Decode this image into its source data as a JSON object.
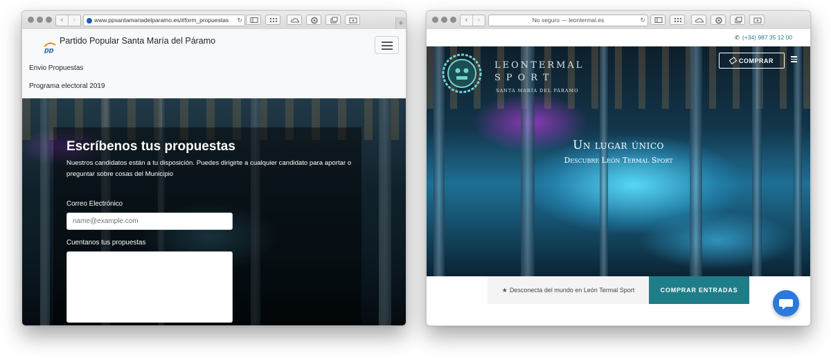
{
  "window1": {
    "address": "www.ppsantamariadelparamo.es/#form_propuestas",
    "site": {
      "brand": "Partido Popular Santa María del Páramo",
      "nav_links": [
        "Envio Propuestas",
        "Programa electoral 2019"
      ],
      "heading": "Escríbenos tus propuestas",
      "lead": "Nuestros candidatos están a tu disposición. Puedes dirigirte a cualquier candidato para aportar o preguntar sobre cosas del Municipio",
      "email_label": "Correo Electrónico",
      "email_placeholder": "name@example.com",
      "proposals_label": "Cuentanos tus propuestas"
    }
  },
  "window2": {
    "address": "No seguro — leontermal.es",
    "site": {
      "phone": "(+34) 987 35 12 00",
      "logo_line1": "LEONTERMAL",
      "logo_line2": "SPORT",
      "logo_line3": "SANTA MARÍA DEL PÁRAMO",
      "comprar_label": "COMPRAR",
      "slogan_title": "Un lugar único",
      "slogan_sub": "Descubre León Termal Sport",
      "bar_text": "Desconecta del mundo en León Termal Sport",
      "cta_label": "COMPRAR ENTRADAS"
    }
  },
  "colors": {
    "accent_teal": "#1f7d88",
    "chat_blue": "#2b79d9",
    "pp_blue": "#1b5fb3",
    "pp_orange": "#f18a1c"
  },
  "icons": [
    "back-icon",
    "forward-icon",
    "reload-icon",
    "sidebar-icon",
    "grid-icon",
    "cloud-icon",
    "gear-icon",
    "tabs-icon",
    "download-icon",
    "plus-icon",
    "phone-icon",
    "ticket-icon",
    "menu-icon",
    "star-icon",
    "chat-icon",
    "site-favicon"
  ]
}
